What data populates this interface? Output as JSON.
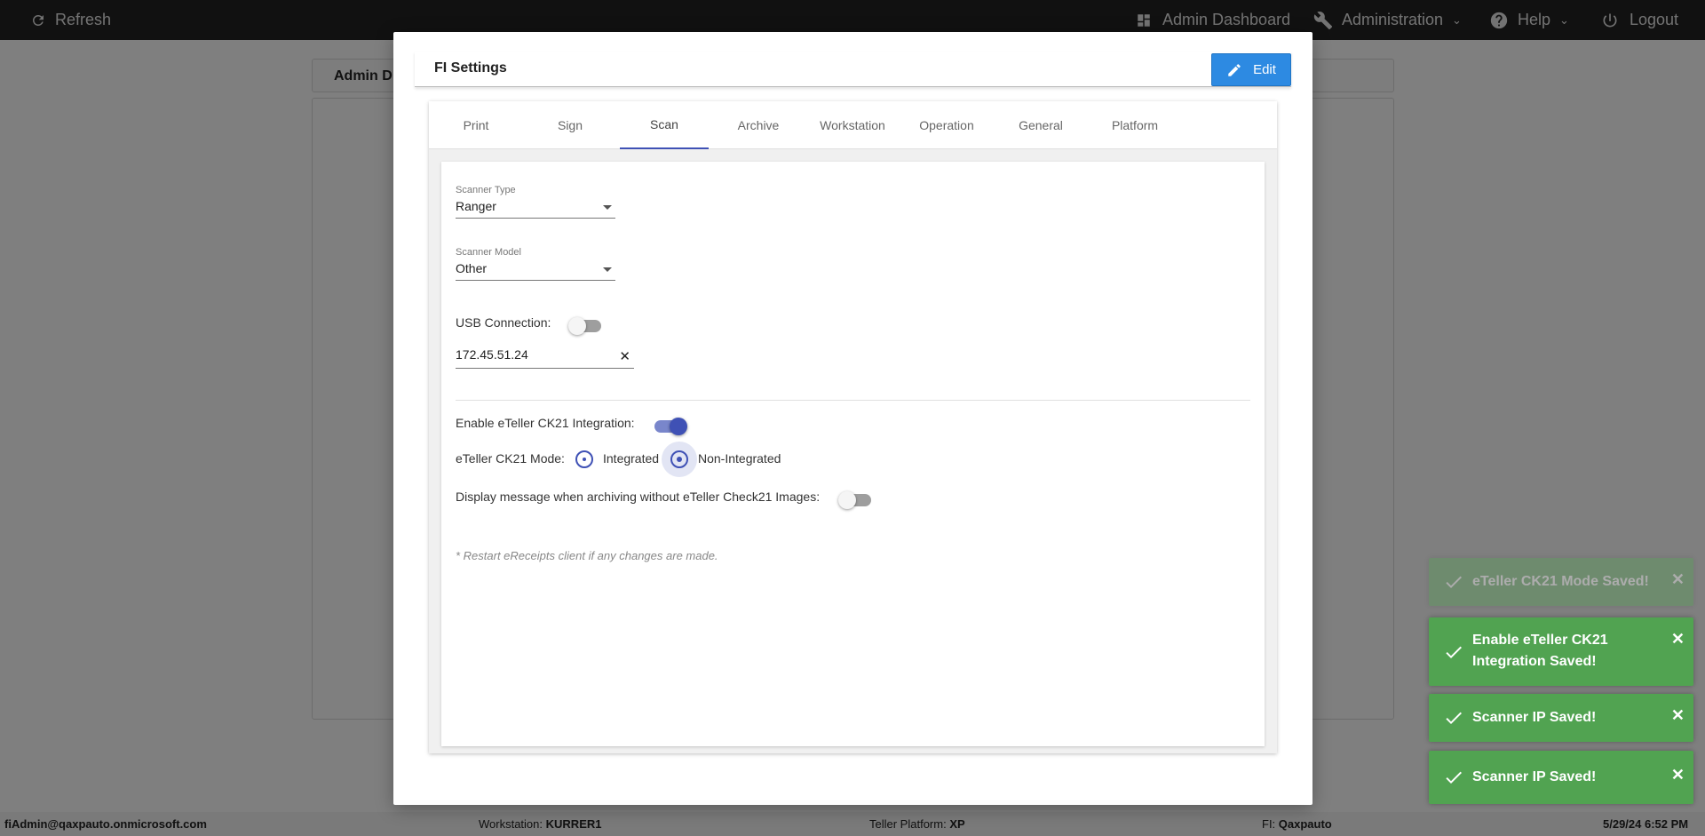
{
  "topbar": {
    "refresh_label": "Refresh",
    "admin_dashboard_label": "Admin Dashboard",
    "administration_label": "Administration",
    "help_label": "Help",
    "logout_label": "Logout"
  },
  "background": {
    "tab_label": "Admin D"
  },
  "modal": {
    "title": "FI Settings",
    "edit_label": "Edit",
    "tabs": [
      {
        "label": "Print"
      },
      {
        "label": "Sign"
      },
      {
        "label": "Scan"
      },
      {
        "label": "Archive"
      },
      {
        "label": "Workstation"
      },
      {
        "label": "Operation"
      },
      {
        "label": "General"
      },
      {
        "label": "Platform"
      }
    ],
    "active_tab": "Scan",
    "scan": {
      "scanner_type_label": "Scanner Type",
      "scanner_type_value": "Ranger",
      "scanner_model_label": "Scanner Model",
      "scanner_model_value": "Other",
      "usb_connection_label": "USB Connection:",
      "usb_connection_on": false,
      "scanner_ip_value": "172.45.51.24",
      "ck21_integration_label": "Enable eTeller CK21 Integration:",
      "ck21_integration_on": true,
      "ck21_mode_label": "eTeller CK21 Mode:",
      "ck21_mode_options": [
        "Integrated",
        "Non-Integrated"
      ],
      "ck21_mode_selected": "Non-Integrated",
      "display_message_label": "Display message when archiving without eTeller Check21 Images:",
      "display_message_on": false,
      "restart_note": "* Restart eReceipts client if any changes are made."
    }
  },
  "toasts": [
    {
      "text": "eTeller CK21 Mode Saved!",
      "faded": true
    },
    {
      "text": "Enable eTeller CK21 Integration Saved!",
      "faded": false
    },
    {
      "text": "Scanner IP Saved!",
      "faded": false
    },
    {
      "text": "Scanner IP Saved!",
      "faded": false
    }
  ],
  "footer": {
    "user": "fiAdmin@qaxpauto.onmicrosoft.com",
    "workstation_label": "Workstation:",
    "workstation_value": "KURRER1",
    "platform_label": "Teller Platform:",
    "platform_value": "XP",
    "fi_label": "FI:",
    "fi_value": "Qaxpauto",
    "datetime": "5/29/24 6:52 PM"
  },
  "colors": {
    "topbar": "#222222",
    "accent": "#3f51b5",
    "edit_button": "#2d8ae2",
    "toast_success": "#51a351"
  }
}
